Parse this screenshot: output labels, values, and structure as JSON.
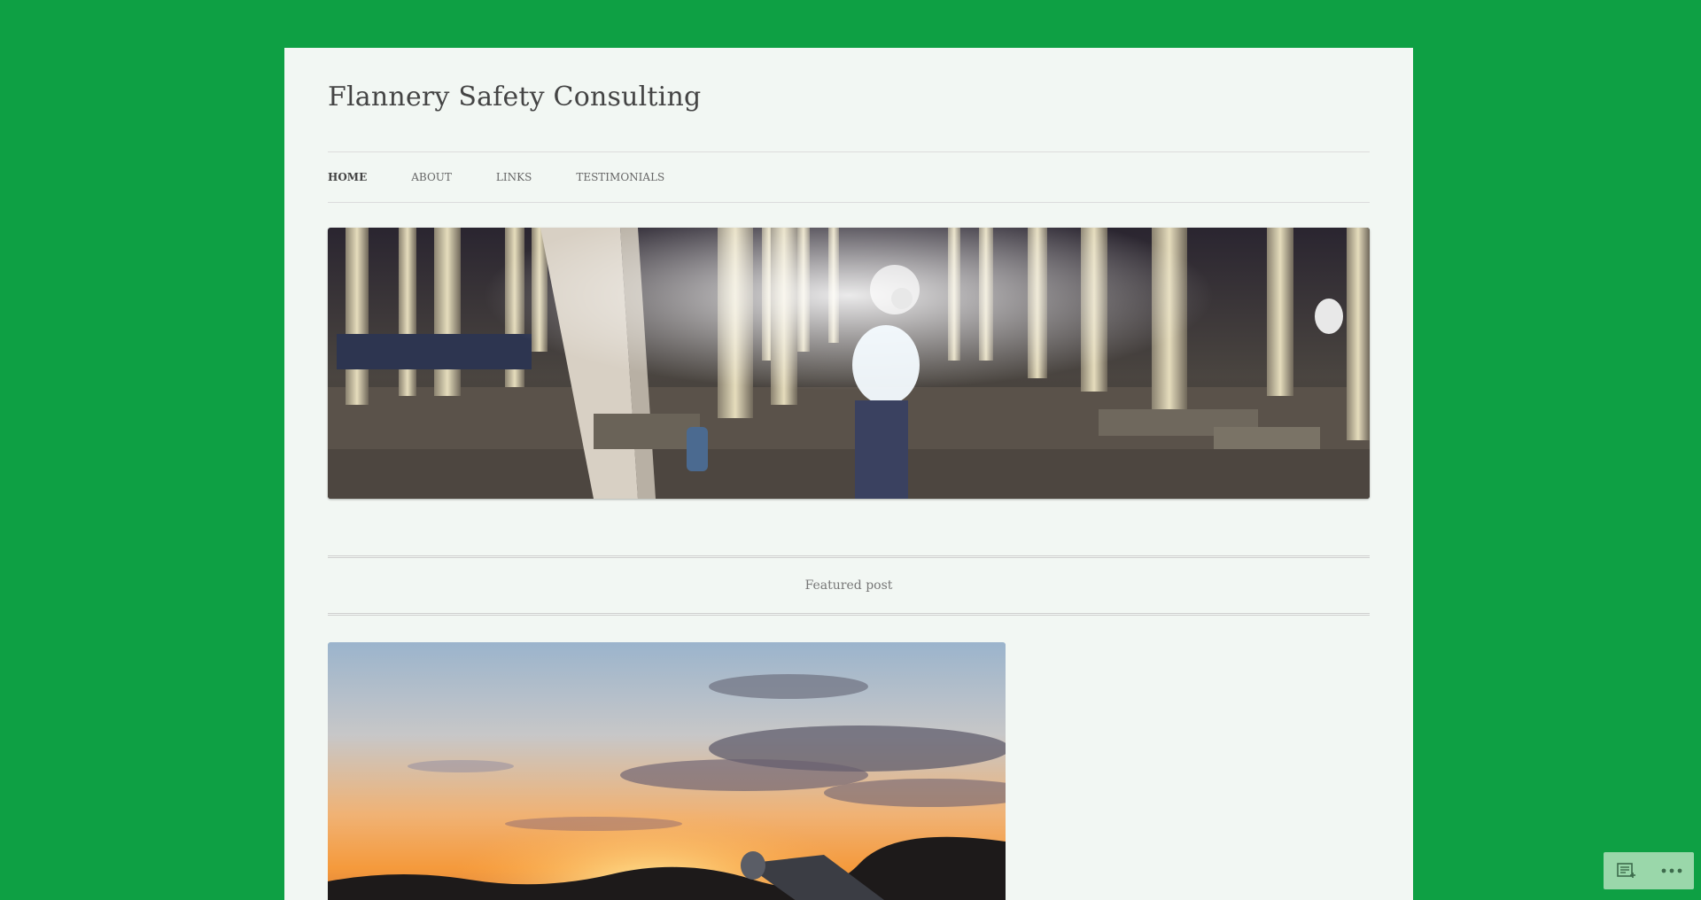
{
  "site": {
    "title": "Flannery Safety Consulting"
  },
  "nav": {
    "items": [
      {
        "label": "HOME",
        "active": true
      },
      {
        "label": "ABOUT",
        "active": false
      },
      {
        "label": "LINKS",
        "active": false
      },
      {
        "label": "TESTIMONIALS",
        "active": false
      }
    ]
  },
  "featured": {
    "label": "Featured post"
  },
  "widget": {
    "icons": [
      "reader-icon",
      "more-icon"
    ]
  },
  "colors": {
    "background": "#0ea044",
    "page": "#f2f7f3",
    "title": "#444444"
  }
}
